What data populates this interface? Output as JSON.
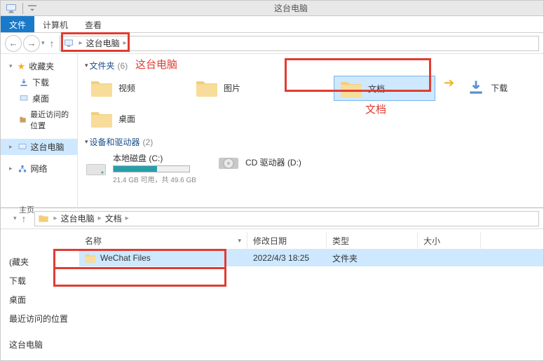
{
  "top": {
    "title": "这台电脑",
    "ribbon": {
      "file": "文件",
      "computer": "计算机",
      "view": "查看"
    },
    "breadcrumb": [
      "这台电脑"
    ],
    "sidebar": {
      "favorites": "收藏夹",
      "downloads": "下载",
      "desktop": "桌面",
      "recent": "最近访问的位置",
      "thispc": "这台电脑",
      "network": "网络"
    },
    "groups": {
      "folders": {
        "label": "文件夹",
        "count": "(6)"
      },
      "drives": {
        "label": "设备和驱动器",
        "count": "(2)"
      }
    },
    "folder_tiles": {
      "videos": "视频",
      "pictures": "图片",
      "documents": "文档",
      "downloads": "下载",
      "desktop": "桌面"
    },
    "drives": {
      "c": {
        "label": "本地磁盘 (C:)",
        "sub": "21.4 GB 可用，共 49.6 GB",
        "fill_pct": 57
      },
      "d": {
        "label": "CD 驱动器 (D:)"
      }
    },
    "annotations": {
      "thispc": "这台电脑",
      "documents": "文档"
    }
  },
  "bot": {
    "breadcrumb": [
      "这台电脑",
      "文档"
    ],
    "sidebar": {
      "fav": "(藏夹",
      "downloads": "下载",
      "desktop": "桌面",
      "recent": "最近访问的位置",
      "thispc": "这台电脑"
    },
    "columns": {
      "name": "名称",
      "date": "修改日期",
      "type": "类型",
      "size": "大小"
    },
    "row": {
      "name": "WeChat Files",
      "date": "2022/4/3 18:25",
      "type": "文件夹",
      "size": ""
    },
    "widths": {
      "name": 240,
      "date": 113,
      "type": 130,
      "size": 90
    }
  },
  "main_label": "主页"
}
